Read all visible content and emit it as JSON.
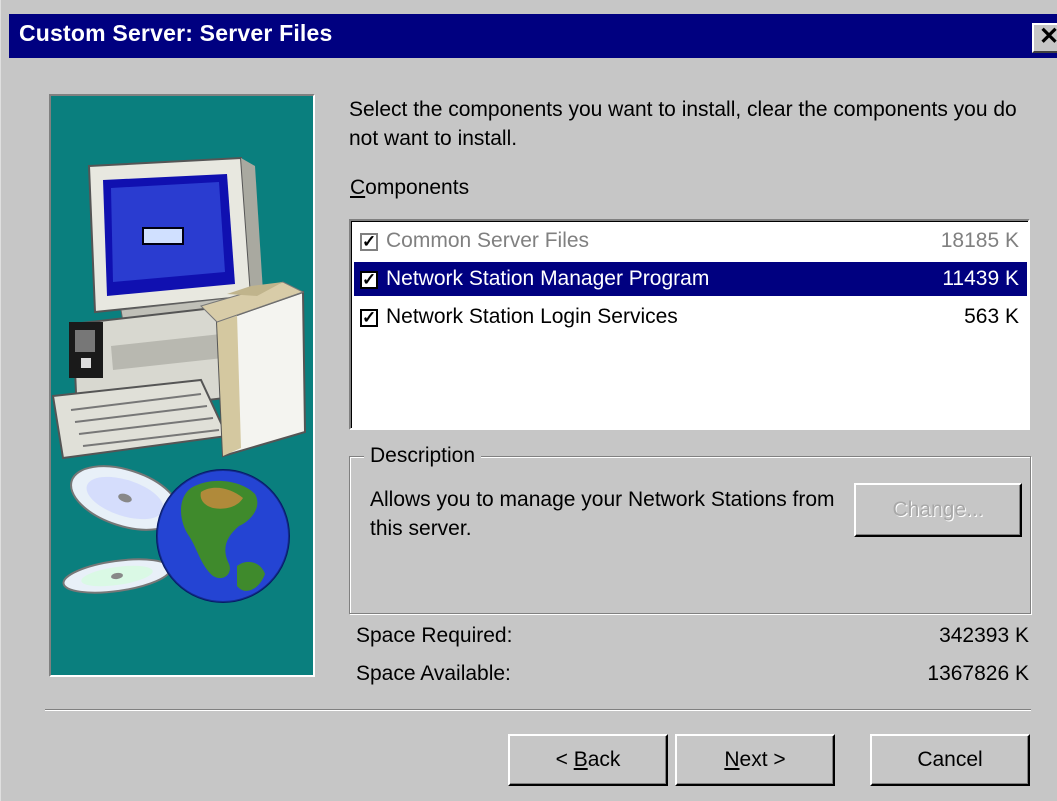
{
  "window": {
    "title": "Custom Server: Server Files",
    "close_glyph": "✕"
  },
  "main": {
    "instructions": "Select the components you want to install, clear the components you do not want to install.",
    "components_label_accel": "C",
    "components_label_rest": "omponents",
    "components": [
      {
        "label": "Common Server Files",
        "size": "18185 K",
        "checked": true,
        "state": "grayed"
      },
      {
        "label": "Network Station Manager Program",
        "size": "11439 K",
        "checked": true,
        "state": "selected"
      },
      {
        "label": "Network Station Login Services",
        "size": "563 K",
        "checked": true,
        "state": "normal"
      }
    ],
    "check_glyph": "✓",
    "description": {
      "legend": "Description",
      "text": "Allows you to manage your Network Stations from this server.",
      "change_button": "Change..."
    },
    "space_required_label": "Space Required:",
    "space_required_value": "342393 K",
    "space_available_label": "Space Available:",
    "space_available_value": "1367826 K"
  },
  "buttons": {
    "back_prefix": "< ",
    "back_accel": "B",
    "back_rest": "ack",
    "next_accel": "N",
    "next_rest": "ext >",
    "cancel": "Cancel"
  },
  "colors": {
    "title_bar": "#000080",
    "dialog": "#c6c6c6",
    "side_panel": "#0a7f7e",
    "selection": "#000080"
  }
}
